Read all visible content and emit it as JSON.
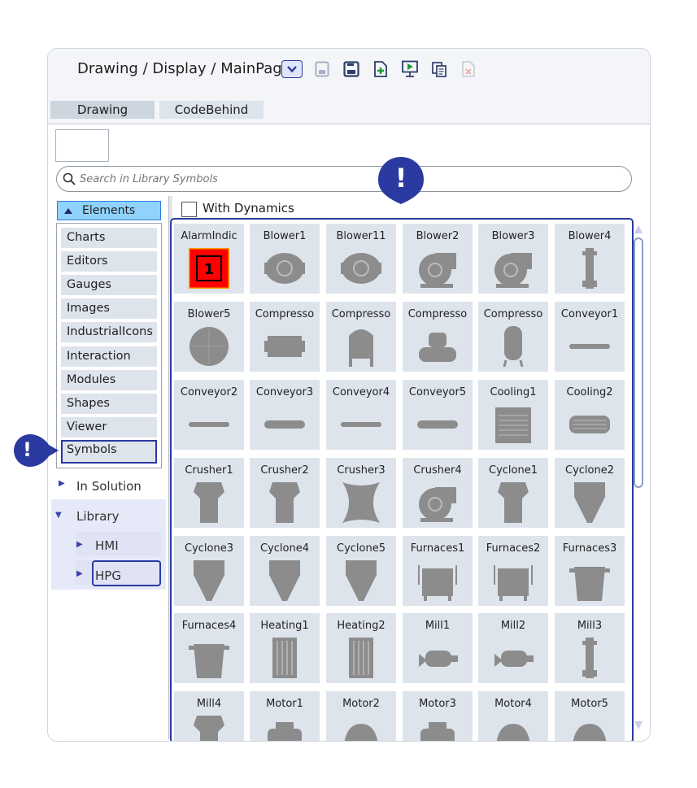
{
  "header": {
    "breadcrumb": "Drawing / Display / MainPage",
    "toolbar_icons": [
      "save-icon",
      "save-as-icon",
      "new-page-icon",
      "run-icon",
      "copy-icon",
      "delete-icon"
    ]
  },
  "tabs": [
    {
      "label": "Drawing",
      "active": true
    },
    {
      "label": "CodeBehind",
      "active": false
    }
  ],
  "search": {
    "placeholder": "Search in Library Symbols",
    "value": ""
  },
  "elements": {
    "header": "Elements",
    "items": [
      "Charts",
      "Editors",
      "Gauges",
      "Images",
      "IndustrialIcons",
      "Interaction",
      "Modules",
      "Shapes",
      "Viewer",
      "Symbols"
    ],
    "selected": "Symbols"
  },
  "tree": {
    "in_solution": "In Solution",
    "library": "Library",
    "hmi": "HMI",
    "hpg": "HPG"
  },
  "dynamics_label": "With Dynamics",
  "symbols": [
    "AlarmIndic",
    "Blower1",
    "Blower11",
    "Blower2",
    "Blower3",
    "Blower4",
    "Blower5",
    "Compresso",
    "Compresso",
    "Compresso",
    "Compresso",
    "Conveyor1",
    "Conveyor2",
    "Conveyor3",
    "Conveyor4",
    "Conveyor5",
    "Cooling1",
    "Cooling2",
    "Crusher1",
    "Crusher2",
    "Crusher3",
    "Crusher4",
    "Cyclone1",
    "Cyclone2",
    "Cyclone3",
    "Cyclone4",
    "Cyclone5",
    "Furnaces1",
    "Furnaces2",
    "Furnaces3",
    "Furnaces4",
    "Heating1",
    "Heating2",
    "Mill1",
    "Mill2",
    "Mill3",
    "Mill4",
    "Motor1",
    "Motor2",
    "Motor3",
    "Motor4",
    "Motor5"
  ],
  "alarm_value": "1",
  "callouts": {
    "mark": "!"
  },
  "colors": {
    "accent": "#2b3aa0",
    "tile": "#dde4ec",
    "symbol": "#8c8c8c",
    "alarm": "#ff0000",
    "alarm_border": "#ff9900"
  }
}
